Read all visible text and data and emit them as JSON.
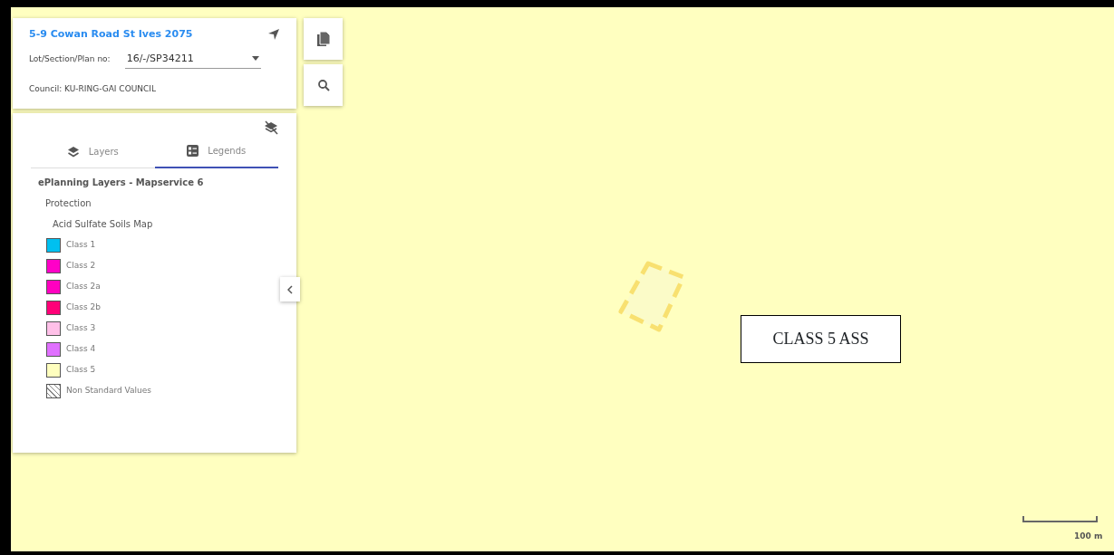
{
  "property": {
    "address": "5-9 Cowan Road St Ives 2075",
    "lot_label": "Lot/Section/Plan no:",
    "lot_value": "16/-/SP34211",
    "council": "Council: KU-RING-GAI COUNCIL"
  },
  "tabs": [
    {
      "label": "Layers",
      "selected": false
    },
    {
      "label": "Legends",
      "selected": true
    }
  ],
  "legend": {
    "service": "ePlanning Layers - Mapservice 6",
    "group": "Protection",
    "layer": "Acid Sulfate Soils Map",
    "items": [
      {
        "label": "Class 1",
        "kind": "swatch",
        "color": "#00c0f0"
      },
      {
        "label": "Class 2",
        "kind": "swatch",
        "color": "#ff00c8"
      },
      {
        "label": "Class 2a",
        "kind": "swatch",
        "color": "#ff00c0"
      },
      {
        "label": "Class 2b",
        "kind": "swatch",
        "color": "#ff0078"
      },
      {
        "label": "Class 3",
        "kind": "swatch",
        "color": "#ffc0e8"
      },
      {
        "label": "Class 4",
        "kind": "swatch",
        "color": "#e070ff"
      },
      {
        "label": "Class 5",
        "kind": "swatch",
        "color": "#ffffbe"
      },
      {
        "label": "Non Standard Values",
        "kind": "hatch"
      }
    ]
  },
  "map": {
    "label": "CLASS 5 ASS",
    "scale": "100 m"
  }
}
